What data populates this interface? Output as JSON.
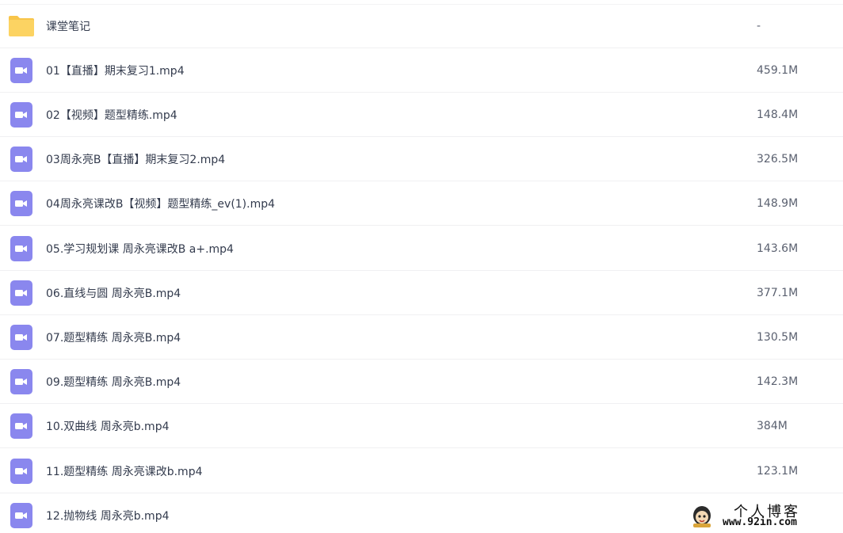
{
  "colors": {
    "folder_icon": "#fcd362",
    "folder_icon_tab": "#f8c54a",
    "video_icon": "#8a87ee",
    "row_divider": "#f0f0f2",
    "name_text": "#333b4d",
    "size_text": "#5b6170"
  },
  "files": [
    {
      "icon": "folder-icon",
      "name": "课堂笔记",
      "size": "-"
    },
    {
      "icon": "video-file-icon",
      "name": "01【直播】期末复习1.mp4",
      "size": "459.1M"
    },
    {
      "icon": "video-file-icon",
      "name": "02【视频】题型精练.mp4",
      "size": "148.4M"
    },
    {
      "icon": "video-file-icon",
      "name": "03周永亮B【直播】期末复习2.mp4",
      "size": "326.5M"
    },
    {
      "icon": "video-file-icon",
      "name": "04周永亮课改B【视频】题型精练_ev(1).mp4",
      "size": "148.9M"
    },
    {
      "icon": "video-file-icon",
      "name": "05.学习规划课 周永亮课改B a+.mp4",
      "size": "143.6M"
    },
    {
      "icon": "video-file-icon",
      "name": "06.直线与圆 周永亮B.mp4",
      "size": "377.1M"
    },
    {
      "icon": "video-file-icon",
      "name": "07.题型精练 周永亮B.mp4",
      "size": "130.5M"
    },
    {
      "icon": "video-file-icon",
      "name": "09.题型精练 周永亮B.mp4",
      "size": "142.3M"
    },
    {
      "icon": "video-file-icon",
      "name": "10.双曲线 周永亮b.mp4",
      "size": "384M"
    },
    {
      "icon": "video-file-icon",
      "name": "11.题型精练 周永亮课改b.mp4",
      "size": "123.1M"
    },
    {
      "icon": "video-file-icon",
      "name": "12.抛物线 周永亮b.mp4",
      "size": ""
    }
  ],
  "watermark": {
    "title": "个人博客",
    "url": "www.92in.com"
  }
}
